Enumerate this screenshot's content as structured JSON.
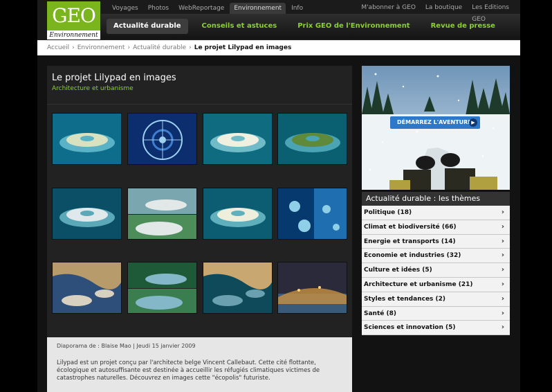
{
  "logo": {
    "brand": "GEO",
    "sub": "Environnement"
  },
  "topnav": [
    {
      "label": "Voyages",
      "active": false
    },
    {
      "label": "Photos",
      "active": false
    },
    {
      "label": "WebReportage",
      "active": false
    },
    {
      "label": "Environnement",
      "active": true
    },
    {
      "label": "Info",
      "active": false
    }
  ],
  "toplinks": [
    "M'abonner à GEO",
    "La boutique",
    "Les Editions"
  ],
  "toplinks_extra": "GEO",
  "subnav": [
    {
      "label": "Actualité durable",
      "active": true
    },
    {
      "label": "Conseils et astuces",
      "active": false
    },
    {
      "label": "Prix GEO de l'Environnement",
      "active": false
    },
    {
      "label": "Revue de presse",
      "active": false
    }
  ],
  "breadcrumb": {
    "items": [
      "Accueil",
      "Environnement",
      "Actualité durable"
    ],
    "current": "Le projet Lilypad en images",
    "separator": "›"
  },
  "article": {
    "title": "Le projet Lilypad en images",
    "category": "Architecture et urbanisme",
    "byline": "Diaporama de : Blaise Mao | Jeudi 15 janvier 2009",
    "description": "Lilypad est un projet conçu par l'architecte belge Vincent Callebaut. Cette cité flottante, écologique et autosuffisante est destinée à accueillir les réfugiés climatiques victimes de catastrophes naturelles. Découvrez en images cette \"écopolis\" futuriste."
  },
  "thumbnails": [
    {
      "theme": "sea-render",
      "colors": [
        "#0d6d8a",
        "#5ab2c6",
        "#d9e2c0"
      ]
    },
    {
      "theme": "blueprint",
      "colors": [
        "#0c2d6e",
        "#3f7fd0",
        "#9ed0f0"
      ]
    },
    {
      "theme": "sea-render",
      "colors": [
        "#0f6b80",
        "#6fbcc8",
        "#f0f0e0"
      ]
    },
    {
      "theme": "sea-render",
      "colors": [
        "#0a6070",
        "#4aa4b4",
        "#5e8a3a"
      ]
    },
    {
      "theme": "sea-render",
      "colors": [
        "#0a4f66",
        "#5aa8b8",
        "#dfe8ea"
      ]
    },
    {
      "theme": "split",
      "colors": [
        "#7aa6b0",
        "#e2e8e8",
        "#4c8d5a"
      ]
    },
    {
      "theme": "sea-render",
      "colors": [
        "#0d5d72",
        "#5fb0bc",
        "#eeeedd"
      ]
    },
    {
      "theme": "aerial",
      "colors": [
        "#063a6e",
        "#1f6fb0",
        "#8fd0e8"
      ]
    },
    {
      "theme": "coast",
      "colors": [
        "#2e4f7a",
        "#b89b6a",
        "#d8d0c0"
      ]
    },
    {
      "theme": "split",
      "colors": [
        "#1e5a38",
        "#84b8c8",
        "#3a7d4e"
      ]
    },
    {
      "theme": "coast",
      "colors": [
        "#0f4a5a",
        "#c8a870",
        "#6aa0b0"
      ]
    },
    {
      "theme": "night",
      "colors": [
        "#2a2a3a",
        "#c89040",
        "#3a5a7a"
      ]
    }
  ],
  "ad": {
    "cta": "DÉMARREZ L'AVENTURE",
    "cta_icon": "play-arrow-icon"
  },
  "themes": {
    "heading": "Actualité durable  : les thèmes",
    "items": [
      "Politique (18)",
      "Climat et biodiversité (66)",
      "Energie et transports (14)",
      "Economie et industries (32)",
      "Culture et idées (5)",
      "Architecture et urbanisme (21)",
      "Styles et tendances (2)",
      "Santé (8)",
      "Sciences et innovation (5)"
    ],
    "chevron": "›"
  },
  "colors": {
    "accent_green": "#8bd12a",
    "logo_green": "#7ab51d",
    "ad_button": "#2d78c8"
  }
}
